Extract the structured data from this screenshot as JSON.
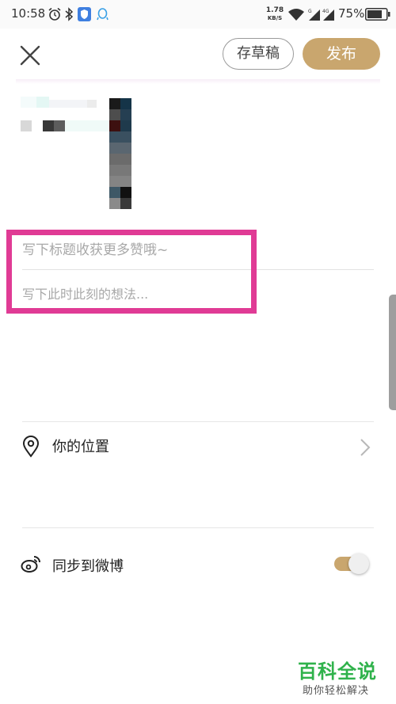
{
  "status_bar": {
    "time": "10:58",
    "net_speed_value": "1.78",
    "net_speed_unit": "KB/S",
    "battery": "75%"
  },
  "header": {
    "draft_label": "存草稿",
    "publish_label": "发布",
    "publish_color": "#c9a66e"
  },
  "form": {
    "title_placeholder": "写下标题收获更多赞哦~",
    "content_placeholder": "写下此时此刻的想法..."
  },
  "location": {
    "label": "你的位置"
  },
  "weibo_sync": {
    "label": "同步到微博",
    "enabled": true
  },
  "highlight_color": "#e03b95",
  "icons": [
    "close-icon",
    "location-pin-icon",
    "chevron-right-icon",
    "weibo-icon",
    "alarm-icon",
    "bluetooth-icon",
    "shield-icon",
    "qq-icon",
    "wifi-icon",
    "signal-icon",
    "battery-icon"
  ],
  "watermark": {
    "title": "百科全说",
    "subtitle": "助你轻松解决"
  }
}
